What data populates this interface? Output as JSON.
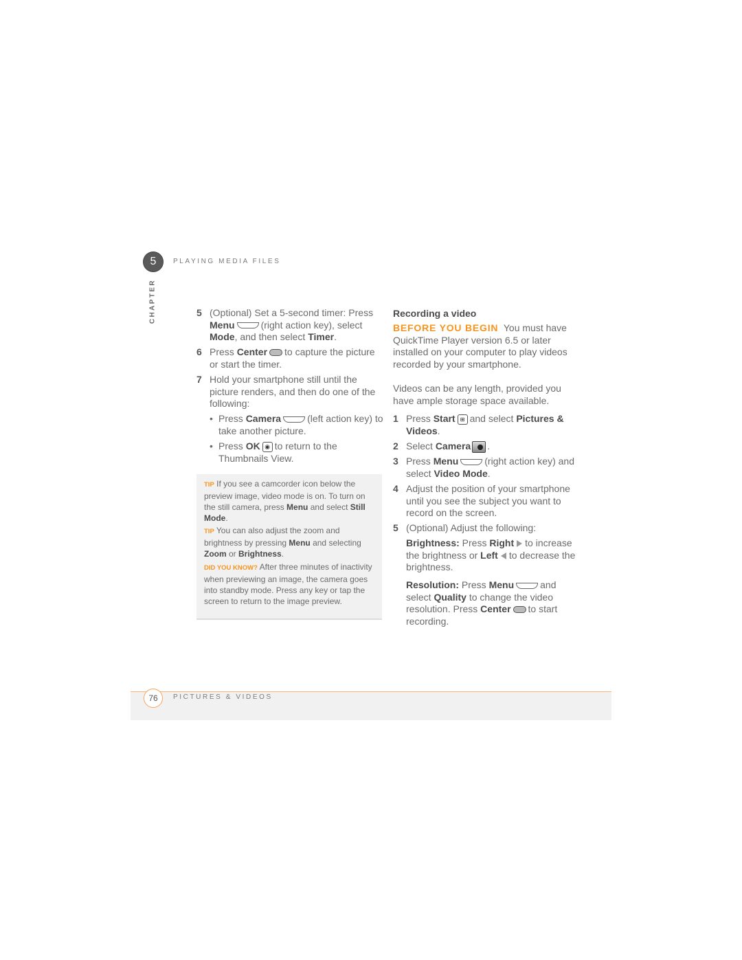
{
  "header": {
    "chapter_number": "5",
    "chapter_label": "CHAPTER",
    "running_title": "PLAYING MEDIA FILES"
  },
  "colors": {
    "accent": "#f7941d",
    "text": "#6a6a6a",
    "bold_text": "#4a4a4a",
    "tip_background": "#f1f1f1"
  },
  "left": {
    "steps": [
      {
        "number": "5",
        "segments": [
          {
            "t": "(Optional) Set a 5-second timer: Press "
          },
          {
            "t": "Menu",
            "b": true
          },
          {
            "icon": "right-action-key-icon"
          },
          {
            "t": "(right action key), select "
          },
          {
            "t": "Mode",
            "b": true
          },
          {
            "t": ", and then select "
          },
          {
            "t": "Timer",
            "b": true
          },
          {
            "t": "."
          }
        ]
      },
      {
        "number": "6",
        "segments": [
          {
            "t": "Press "
          },
          {
            "t": "Center",
            "b": true
          },
          {
            "icon": "center-key-icon"
          },
          {
            "t": "to capture the picture or start the timer."
          }
        ]
      },
      {
        "number": "7",
        "segments": [
          {
            "t": "Hold your smartphone still until the picture renders, and then do one of the following:"
          }
        ]
      }
    ],
    "bullets": [
      {
        "segments": [
          {
            "t": "Press "
          },
          {
            "t": "Camera",
            "b": true
          },
          {
            "icon": "left-action-key-icon"
          },
          {
            "t": "(left action key) to take another picture."
          }
        ]
      },
      {
        "segments": [
          {
            "t": "Press "
          },
          {
            "t": "OK",
            "b": true
          },
          {
            "icon": "ok-key-icon"
          },
          {
            "t": "to return to the Thumbnails View."
          }
        ]
      }
    ],
    "tips": [
      {
        "label": "TIP",
        "segments": [
          {
            "t": " If you see a camcorder icon below the preview image, video mode is on. To turn on the still camera, press "
          },
          {
            "t": "Menu",
            "b": true
          },
          {
            "t": " and select "
          },
          {
            "t": "Still Mode",
            "b": true
          },
          {
            "t": "."
          }
        ]
      },
      {
        "label": "TIP",
        "segments": [
          {
            "t": " You can also adjust the zoom and brightness by pressing "
          },
          {
            "t": "Menu",
            "b": true
          },
          {
            "t": " and selecting "
          },
          {
            "t": "Zoom",
            "b": true
          },
          {
            "t": " or "
          },
          {
            "t": "Brightness",
            "b": true
          },
          {
            "t": "."
          }
        ]
      },
      {
        "label": "DID YOU KNOW?",
        "segments": [
          {
            "t": " After three minutes of inactivity when previewing an image, the camera goes into standby mode. Press any key or tap the screen to return to the image preview."
          }
        ]
      }
    ]
  },
  "right": {
    "heading": "Recording a video",
    "before_label": "BEFORE YOU BEGIN",
    "before_text": "  You must have QuickTime Player version 6.5 or later installed on your computer to play videos recorded by your smartphone.",
    "intro": "Videos can be any length, provided you have ample storage space available.",
    "steps": [
      {
        "number": "1",
        "segments": [
          {
            "t": "Press "
          },
          {
            "t": "Start",
            "b": true
          },
          {
            "icon": "start-icon"
          },
          {
            "t": "and select "
          },
          {
            "t": "Pictures & Videos",
            "b": true
          },
          {
            "t": "."
          }
        ]
      },
      {
        "number": "2",
        "segments": [
          {
            "t": "Select "
          },
          {
            "t": "Camera",
            "b": true
          },
          {
            "icon": "camera-icon"
          },
          {
            "t": "."
          }
        ]
      },
      {
        "number": "3",
        "segments": [
          {
            "t": "Press "
          },
          {
            "t": "Menu",
            "b": true
          },
          {
            "icon": "right-action-key-icon"
          },
          {
            "t": "(right action key) and select "
          },
          {
            "t": "Video Mode",
            "b": true
          },
          {
            "t": "."
          }
        ]
      },
      {
        "number": "4",
        "segments": [
          {
            "t": "Adjust the position of your smartphone until you see the subject you want to record on the screen."
          }
        ]
      },
      {
        "number": "5",
        "segments": [
          {
            "t": "(Optional) Adjust the following:"
          }
        ]
      }
    ],
    "sub": [
      {
        "segments": [
          {
            "t": "Brightness:",
            "b": true
          },
          {
            "t": " Press "
          },
          {
            "t": "Right",
            "b": true
          },
          {
            "icon": "right-arrow-icon"
          },
          {
            "t": "to increase the brightness or "
          },
          {
            "t": "Left",
            "b": true
          },
          {
            "icon": "left-arrow-icon"
          },
          {
            "t": "to decrease the brightness."
          }
        ]
      },
      {
        "segments": [
          {
            "t": "Resolution:",
            "b": true
          },
          {
            "t": " Press "
          },
          {
            "t": "Menu",
            "b": true
          },
          {
            "icon": "right-action-key-icon"
          },
          {
            "t": "and select "
          },
          {
            "t": "Quality",
            "b": true
          },
          {
            "t": " to change the video resolution. Press "
          },
          {
            "t": "Center",
            "b": true
          },
          {
            "icon": "center-key-icon"
          },
          {
            "t": "to start recording."
          }
        ]
      }
    ]
  },
  "footer": {
    "page_number": "76",
    "section_title": "PICTURES & VIDEOS"
  }
}
